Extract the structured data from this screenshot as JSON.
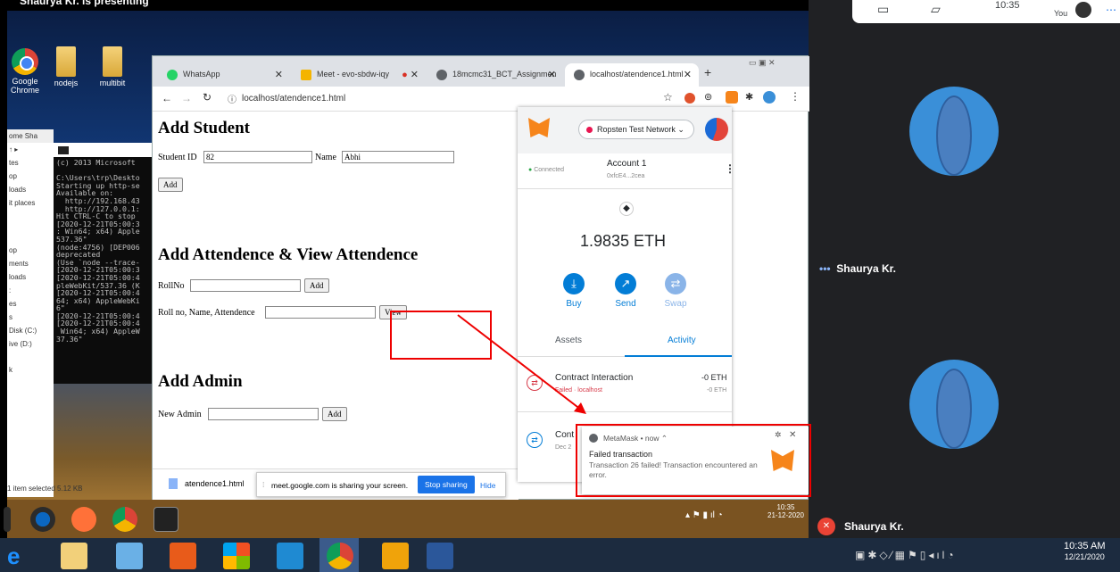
{
  "presenting_text": "Shaurya Kr. is presenting",
  "meet_top": {
    "time": "10:35",
    "you_label": "You"
  },
  "desktop_icons": [
    "Google Chrome",
    "nodejs",
    "multibit"
  ],
  "explorer": {
    "tabs": "ome   Sha",
    "items": [
      "tes",
      "op",
      "loads",
      "it places",
      "op",
      "ments",
      "loads",
      ":",
      "es",
      "s",
      "Disk (C:)",
      "ive (D:)",
      "k"
    ],
    "status": "1 item selected  5.12 KB"
  },
  "cmd_text": "(c) 2013 Microsoft\n\nC:\\Users\\trp\\Deskto\nStarting up http-se\nAvailable on:\n  http://192.168.43\n  http://127.0.0.1:\nHit CTRL-C to stop\n[2020-12-21T05:00:3\n: Win64; x64) Apple\n537.36\"\n(node:4756) [DEP006\ndeprecated\n(Use `node --trace-\n[2020-12-21T05:00:3\n[2020-12-21T05:00:4\npleWebKit/537.36 (K\n[2020-12-21T05:00:4\n64; x64) AppleWebKi\n6\"\n[2020-12-21T05:00:4\n[2020-12-21T05:00:4\n Win64; x64) AppleW\n37.36\"",
  "browser": {
    "tabs": [
      {
        "label": "WhatsApp",
        "color": "#25d366"
      },
      {
        "label": "Meet - evo-sbdw-iqy",
        "color": "#f4b400"
      },
      {
        "label": "18mcmc31_BCT_Assignmen",
        "color": "#5f6368"
      },
      {
        "label": "localhost/atendence1.html",
        "color": "#5f6368"
      }
    ],
    "url": "localhost/atendence1.html"
  },
  "page": {
    "add_student_title": "Add Student",
    "student_id_label": "Student ID",
    "student_id_value": "82",
    "name_label": "Name",
    "name_value": "Abhi",
    "add_button": "Add",
    "attendance_title": "Add Attendence & View Attendence",
    "rollno_label": "RollNo",
    "rollno_add": "Add",
    "roll_name_label": "Roll no, Name, Attendence",
    "view_button": "View",
    "admin_title": "Add Admin",
    "new_admin_label": "New Admin",
    "admin_add": "Add"
  },
  "download_bar": {
    "file": "atendence1.html",
    "share_text": "meet.google.com is sharing your screen.",
    "stop_button": "Stop sharing",
    "hide_button": "Hide"
  },
  "metamask": {
    "network": "Ropsten Test Network",
    "connected": "Connected",
    "account_name": "Account 1",
    "account_addr": "0xfcE4...2cea",
    "balance": "1.9835 ETH",
    "actions": [
      "Buy",
      "Send",
      "Swap"
    ],
    "tabs": [
      "Assets",
      "Activity"
    ],
    "tx1_title": "Contract Interaction",
    "tx1_amount": "-0 ETH",
    "tx1_status": "Failed · localhost",
    "tx1_amount2": "-0 ETH",
    "tx2_title": "Cont",
    "tx2_date": "Dec 2"
  },
  "notification": {
    "app": "MetaMask",
    "when": "now",
    "title": "Failed transaction",
    "body": "Transaction 26 failed! Transaction encountered an error."
  },
  "inner_tray": {
    "time": "10:35",
    "date": "21-12-2020"
  },
  "meet": {
    "participant1": "Shaurya Kr.",
    "participant2": "Shaurya Kr."
  },
  "os_tray": {
    "time": "10:35 AM",
    "date": "12/21/2020"
  }
}
